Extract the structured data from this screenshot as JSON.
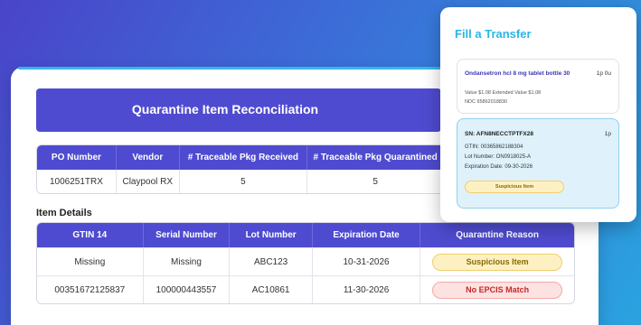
{
  "main": {
    "title": "Quarantine Item Reconciliation",
    "summary": {
      "headers": [
        "PO Number",
        "Vendor",
        "# Traceable Pkg Received",
        "# Traceable Pkg Quarantined"
      ],
      "row": [
        "1006251TRX",
        "Claypool RX",
        "5",
        "5"
      ]
    },
    "item_details": {
      "label": "Item Details",
      "headers": [
        "GTIN 14",
        "Serial Number",
        "Lot Number",
        "Expiration Date",
        "Quarantine Reason"
      ],
      "rows": [
        [
          "Missing",
          "Missing",
          "ABC123",
          "10-31-2026",
          "Suspicious Item"
        ],
        [
          "00351672125837",
          "100000443557",
          "AC10861",
          "11-30-2026",
          "No EPCIS Match"
        ]
      ]
    }
  },
  "transfer": {
    "title": "Fill a Transfer",
    "product": {
      "name": "Ondansetron hcl 8 mg tablet bottle 30",
      "qty": "1p 0u",
      "value_line": "Value $1.08 Extended Value $1.08",
      "ndc_line": "NDC 65862018830"
    },
    "serial": {
      "sn": "SN: AFN8NECCTPTFX28",
      "qty": "1p",
      "gtin": "GTIN: 00365862188304",
      "lot": "Lot Number: ON0918025-A",
      "expiration": "Expiration Date: 09-30-2026",
      "reason": "Suspicious Item"
    }
  },
  "colors": {
    "header": "#4f4bd0",
    "accent": "#29b6e8",
    "warn": "#fdf1c4",
    "error": "#fde2e2"
  }
}
